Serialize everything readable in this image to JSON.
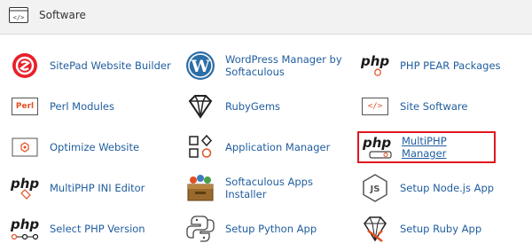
{
  "header": {
    "title": "Software",
    "icon": "code-window-icon"
  },
  "items": {
    "sitepad": {
      "label": "SitePad Website Builder",
      "icon": "sitepad-logo-icon"
    },
    "wordpress": {
      "label": "WordPress Manager by Softaculous",
      "icon": "wordpress-logo-icon"
    },
    "php_pear": {
      "label": "PHP PEAR Packages",
      "icon": "php-pear-icon"
    },
    "perl": {
      "label": "Perl Modules",
      "icon": "perl-icon"
    },
    "rubygems": {
      "label": "RubyGems",
      "icon": "gem-icon"
    },
    "site_software": {
      "label": "Site Software",
      "icon": "code-brackets-icon"
    },
    "optimize": {
      "label": "Optimize Website",
      "icon": "optimize-icon"
    },
    "app_manager": {
      "label": "Application Manager",
      "icon": "app-grid-icon"
    },
    "multiphp_manager": {
      "label": "MultiPHP Manager",
      "icon": "php-manager-icon"
    },
    "multiphp_ini": {
      "label": "MultiPHP INI Editor",
      "icon": "php-ini-icon"
    },
    "softaculous": {
      "label": "Softaculous Apps Installer",
      "icon": "softaculous-box-icon"
    },
    "nodejs": {
      "label": "Setup Node.js App",
      "icon": "nodejs-icon"
    },
    "select_php": {
      "label": "Select PHP Version",
      "icon": "php-select-icon"
    },
    "python": {
      "label": "Setup Python App",
      "icon": "python-icon"
    },
    "ruby": {
      "label": "Setup Ruby App",
      "icon": "ruby-icon"
    }
  },
  "icon_text": {
    "php": "php",
    "perl": "Perl",
    "code": "</>"
  },
  "colors": {
    "link": "#1f5d9e",
    "highlight_border": "#e0181e",
    "accent_orange": "#e34f22",
    "sitepad_red": "#e8202a",
    "wordpress_blue": "#2c6ea6",
    "header_bg": "#f2f2f2"
  }
}
